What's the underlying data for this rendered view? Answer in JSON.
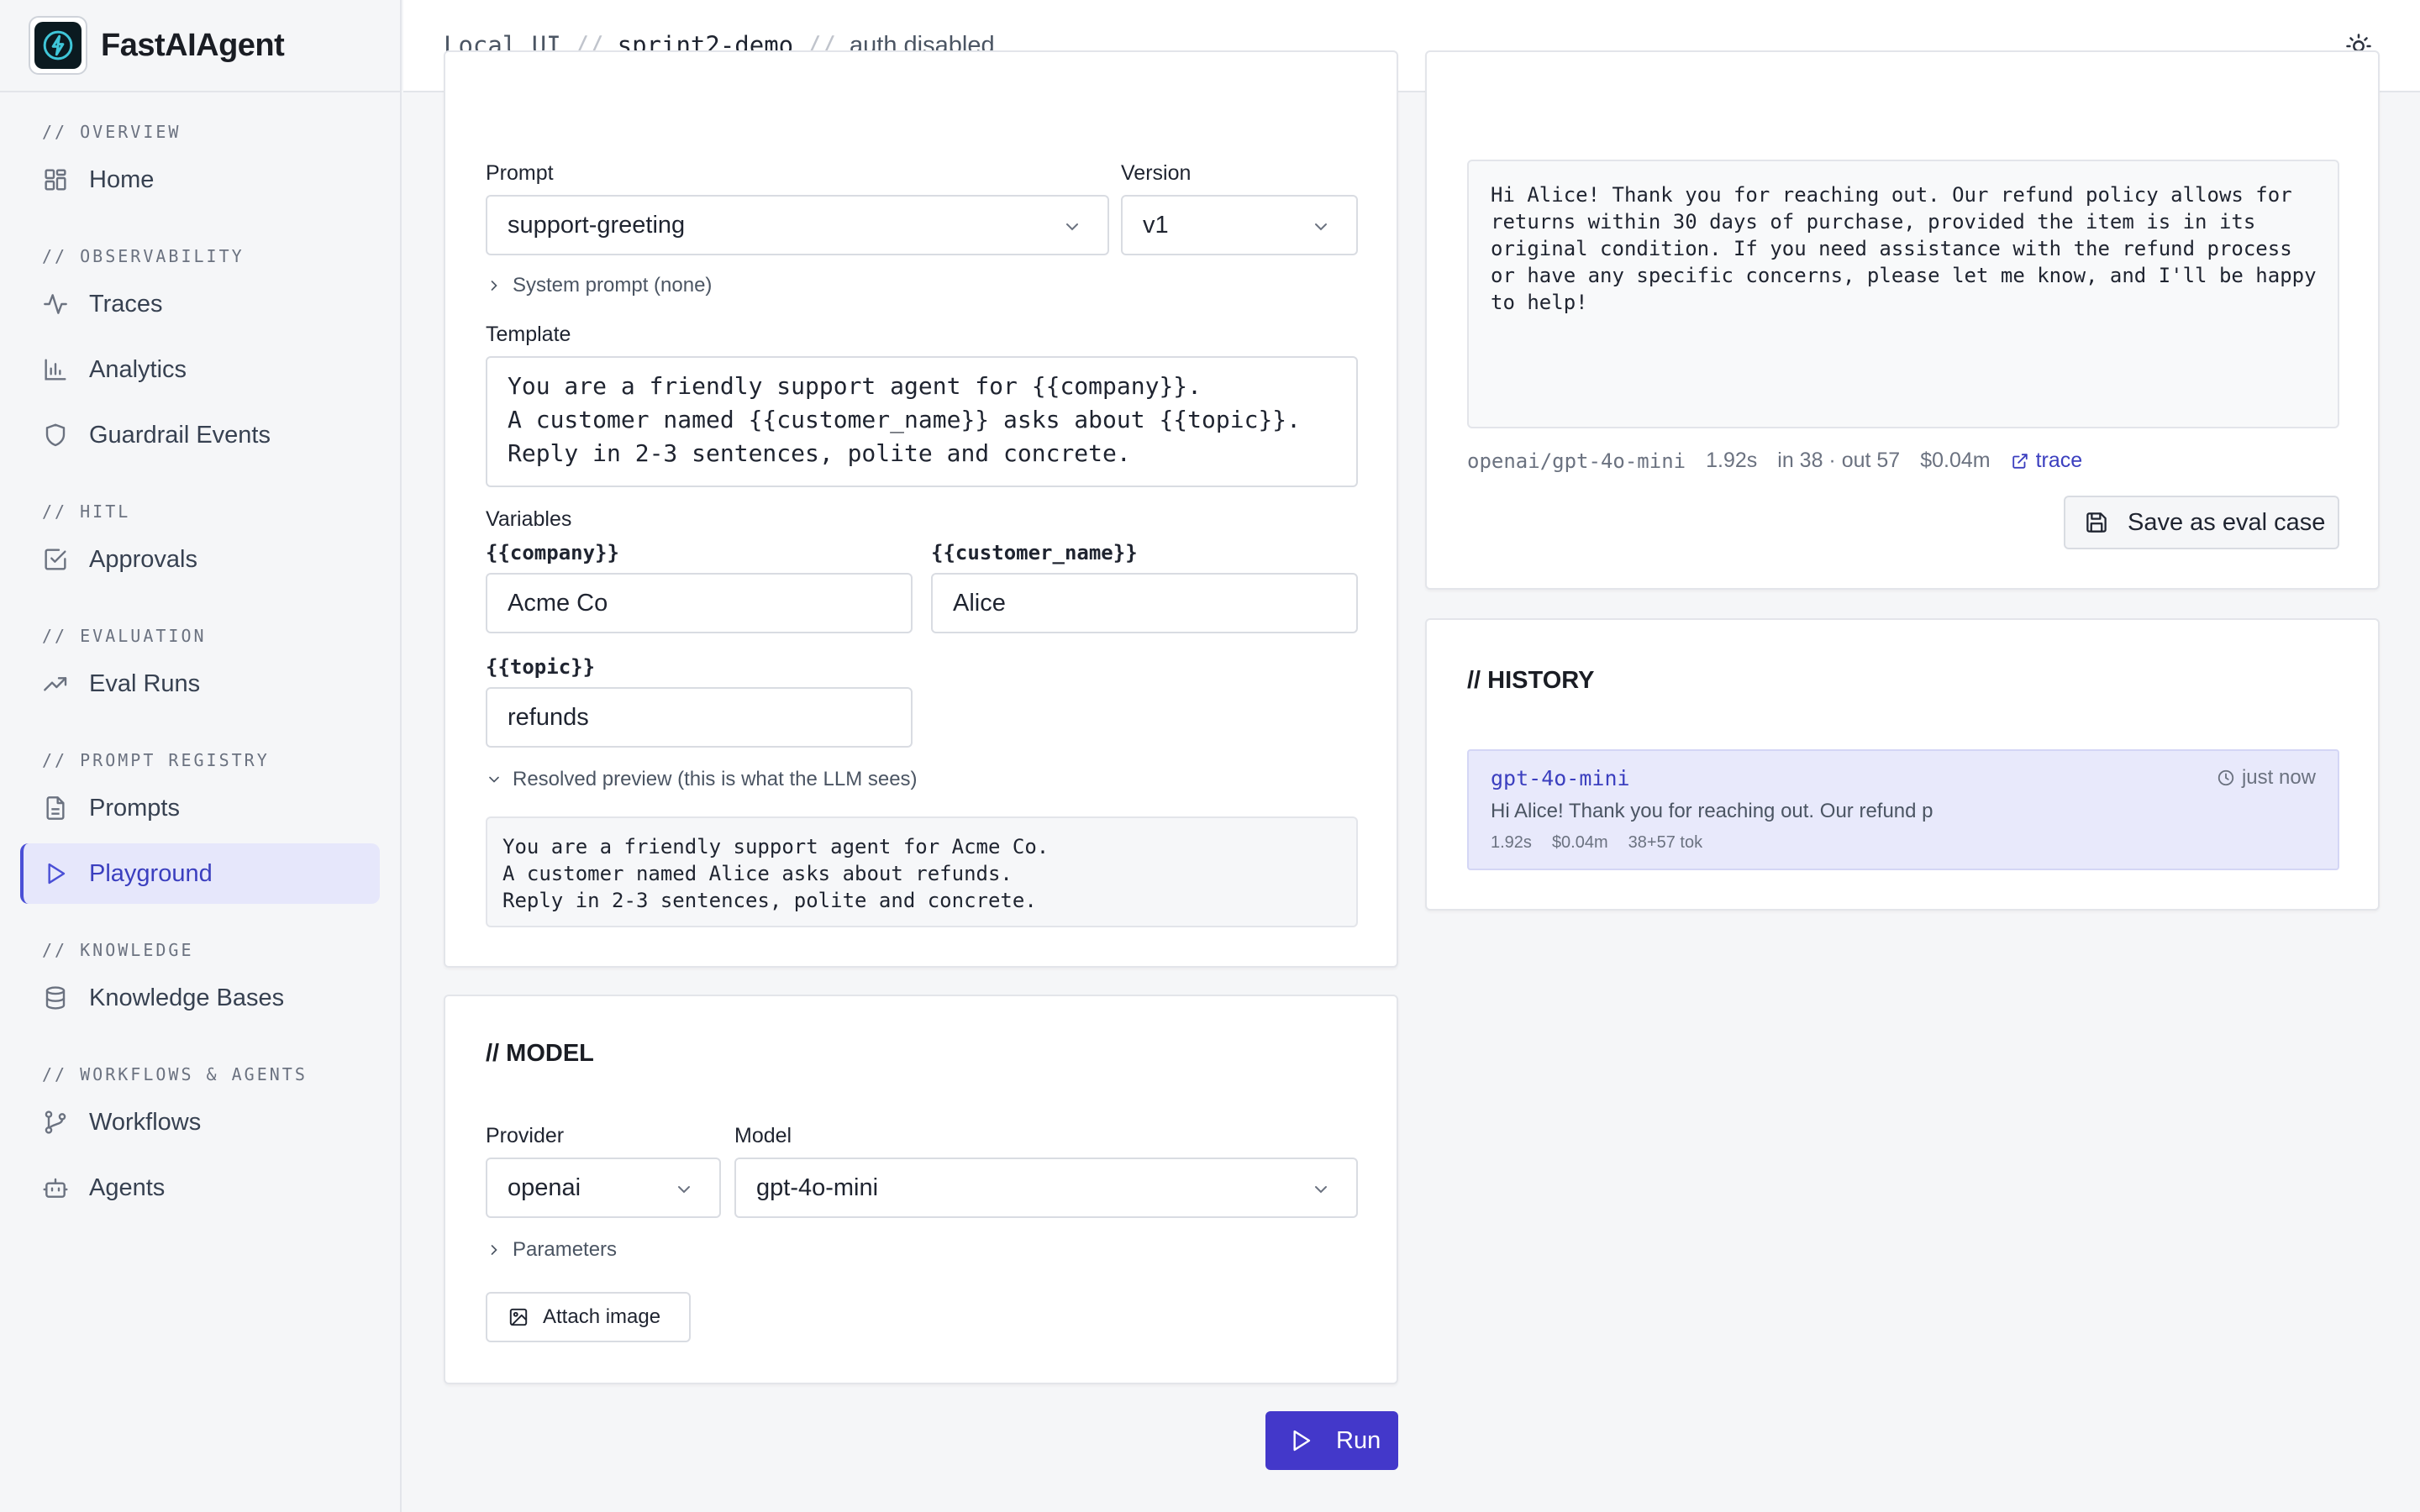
{
  "brand": {
    "name": "FastAIAgent"
  },
  "breadcrumb": {
    "part1": "Local UI",
    "sep": "//",
    "part2": "sprint2-demo",
    "part3": "auth disabled"
  },
  "sidebar": {
    "sections": [
      {
        "title": "// OVERVIEW",
        "items": [
          {
            "label": "Home",
            "icon": "grid-icon"
          }
        ]
      },
      {
        "title": "// OBSERVABILITY",
        "items": [
          {
            "label": "Traces",
            "icon": "activity-icon"
          },
          {
            "label": "Analytics",
            "icon": "bar-chart-icon"
          },
          {
            "label": "Guardrail Events",
            "icon": "shield-icon"
          }
        ]
      },
      {
        "title": "// HITL",
        "items": [
          {
            "label": "Approvals",
            "icon": "check-square-icon"
          }
        ]
      },
      {
        "title": "// EVALUATION",
        "items": [
          {
            "label": "Eval Runs",
            "icon": "trending-up-icon"
          }
        ]
      },
      {
        "title": "// PROMPT REGISTRY",
        "items": [
          {
            "label": "Prompts",
            "icon": "file-text-icon"
          },
          {
            "label": "Playground",
            "icon": "play-icon",
            "active": true
          }
        ]
      },
      {
        "title": "// KNOWLEDGE",
        "items": [
          {
            "label": "Knowledge Bases",
            "icon": "database-icon"
          }
        ]
      },
      {
        "title": "// WORKFLOWS & AGENTS",
        "items": [
          {
            "label": "Workflows",
            "icon": "git-branch-icon"
          },
          {
            "label": "Agents",
            "icon": "bot-icon"
          }
        ]
      }
    ]
  },
  "prompt_card": {
    "prompt_label": "Prompt",
    "prompt_value": "support-greeting",
    "version_label": "Version",
    "version_value": "v1",
    "system_toggle": "System prompt (none)",
    "template_label": "Template",
    "template_text": "You are a friendly support agent for {{company}}.\nA customer named {{customer_name}} asks about {{topic}}.\nReply in 2-3 sentences, polite and concrete.",
    "variables_label": "Variables",
    "variables": [
      {
        "name": "{{company}}",
        "value": "Acme Co"
      },
      {
        "name": "{{customer_name}}",
        "value": "Alice"
      },
      {
        "name": "{{topic}}",
        "value": "refunds"
      }
    ],
    "preview_toggle": "Resolved preview (this is what the LLM sees)",
    "preview_text": "You are a friendly support agent for Acme Co.\nA customer named Alice asks about refunds.\nReply in 2-3 sentences, polite and concrete."
  },
  "model_card": {
    "title": "// MODEL",
    "provider_label": "Provider",
    "provider_value": "openai",
    "model_label": "Model",
    "model_value": "gpt-4o-mini",
    "params_toggle": "Parameters",
    "attach_label": "Attach image"
  },
  "run_button": {
    "label": "Run"
  },
  "response_card": {
    "text": "Hi Alice! Thank you for reaching out. Our refund policy allows for\nreturns within 30 days of purchase, provided the item is in its\noriginal condition. If you need assistance with the refund process\nor have any specific concerns, please let me know, and I'll be happy\nto help!",
    "model": "openai/gpt-4o-mini",
    "latency": "1.92s",
    "tokens": "in 38 · out 57",
    "cost": "$0.04m",
    "trace_label": "trace",
    "save_label": "Save as eval case"
  },
  "history_card": {
    "title": "// HISTORY",
    "entries": [
      {
        "model": "gpt-4o-mini",
        "time": "just now",
        "snippet": "Hi Alice! Thank you for reaching out. Our refund p",
        "latency": "1.92s",
        "cost": "$0.04m",
        "tokens": "38+57 tok"
      }
    ]
  },
  "colors": {
    "accent": "#4338ca",
    "active_bg": "#e6e7fb",
    "history_bg": "#e8e9fb"
  }
}
